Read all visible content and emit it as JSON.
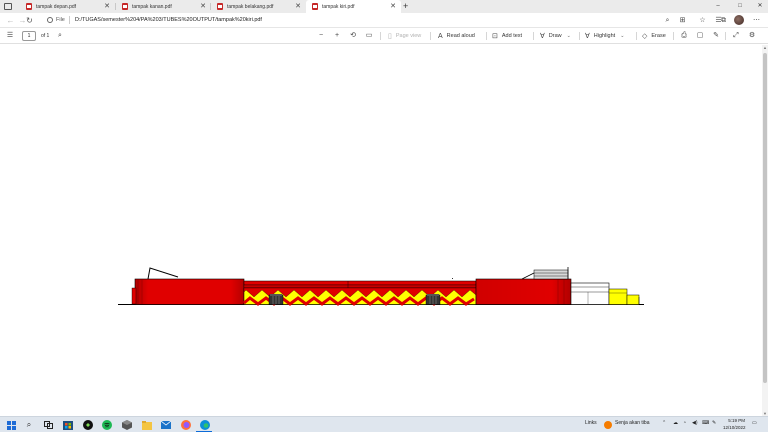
{
  "tabs": [
    {
      "title": "tampak depan.pdf",
      "active": false
    },
    {
      "title": "tampak kanan.pdf",
      "active": false
    },
    {
      "title": "tampak belakang.pdf",
      "active": false
    },
    {
      "title": "tampak kiri.pdf",
      "active": true
    }
  ],
  "window_controls": {
    "minimize": "–",
    "maximize": "□",
    "close": "✕"
  },
  "address_bar": {
    "scheme_label": "File",
    "url": "D:/TUGAS/semester%204/PA%203/TUBES%20OUTPUT/tampak%20kiri.pdf"
  },
  "pdf_toolbar": {
    "page_input": "1",
    "page_total": "of 1",
    "page_view_label": "Page view",
    "read_aloud_label": "Read aloud",
    "add_text_label": "Add text",
    "draw_label": "Draw",
    "highlight_label": "Highlight",
    "erase_label": "Erase"
  },
  "taskbar": {
    "links_label": "Links",
    "weather_text": "Senja akan tiba",
    "time": "5:19 PM",
    "date": "12/10/2022"
  },
  "colors": {
    "building_red": "#e00000",
    "zigzag_yellow": "#ffff00",
    "tab_strip": "#ebebeb",
    "taskbar": "#dfe6ee"
  }
}
